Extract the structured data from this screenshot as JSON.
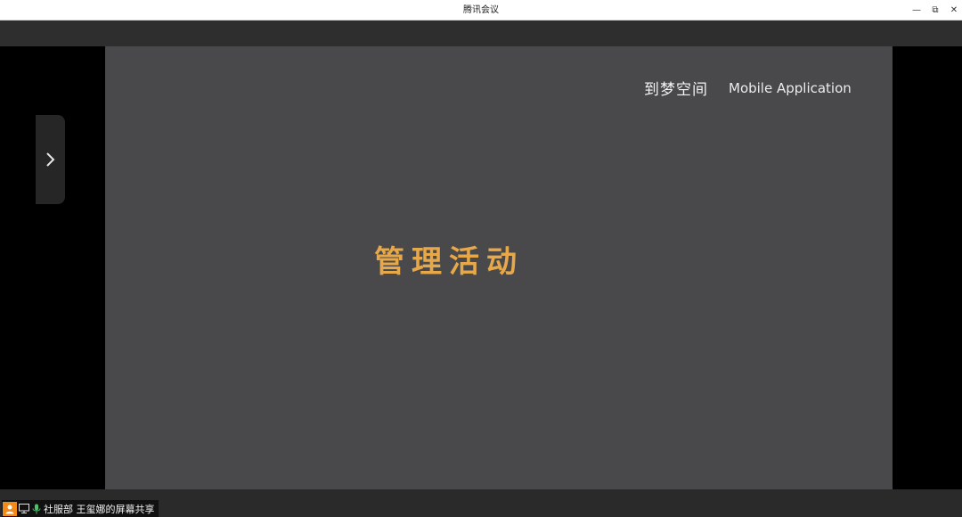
{
  "window": {
    "title": "腾讯会议",
    "minimize_glyph": "—",
    "restore_glyph": "⧉",
    "close_glyph": "✕"
  },
  "slide": {
    "brand": "到梦空间",
    "tag": "Mobile Application",
    "title": "管理活动",
    "background_color": "#49494b",
    "title_color": "#e7a84a"
  },
  "sidebar_toggle": {
    "icon": "chevron-right-icon"
  },
  "status": {
    "share_label": "社服部 王玺娜的屏幕共享",
    "avatar_color": "#f28a1a"
  }
}
